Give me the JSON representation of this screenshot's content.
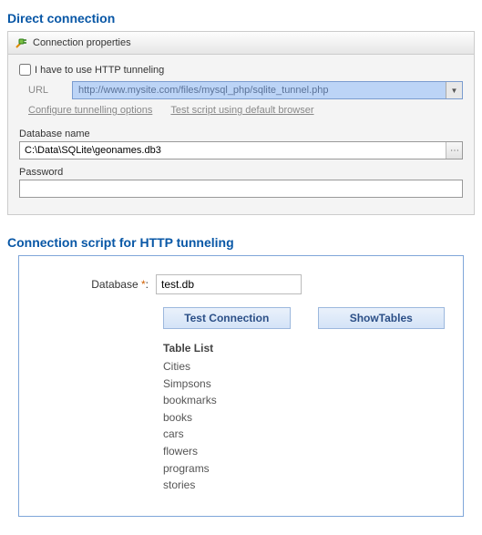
{
  "direct": {
    "heading": "Direct connection",
    "panel_title": "Connection properties",
    "use_tunneling_label": "I have to use HTTP tunneling",
    "use_tunneling_checked": false,
    "url_label": "URL",
    "url_value": "http://www.mysite.com/files/mysql_php/sqlite_tunnel.php",
    "configure_link": "Configure tunnelling options",
    "testscript_link": "Test script using default browser",
    "db_label": "Database name",
    "db_value": "C:\\Data\\SQLite\\geonames.db3",
    "password_label": "Password",
    "password_value": ""
  },
  "script": {
    "heading": "Connection script for HTTP tunneling",
    "db_label": "Database",
    "db_req": "*",
    "db_value": "test.db",
    "test_btn": "Test Connection",
    "show_btn": "ShowTables",
    "list_heading": "Table List",
    "tables": [
      "Cities",
      "Simpsons",
      "bookmarks",
      "books",
      "cars",
      "flowers",
      "programs",
      "stories"
    ]
  }
}
